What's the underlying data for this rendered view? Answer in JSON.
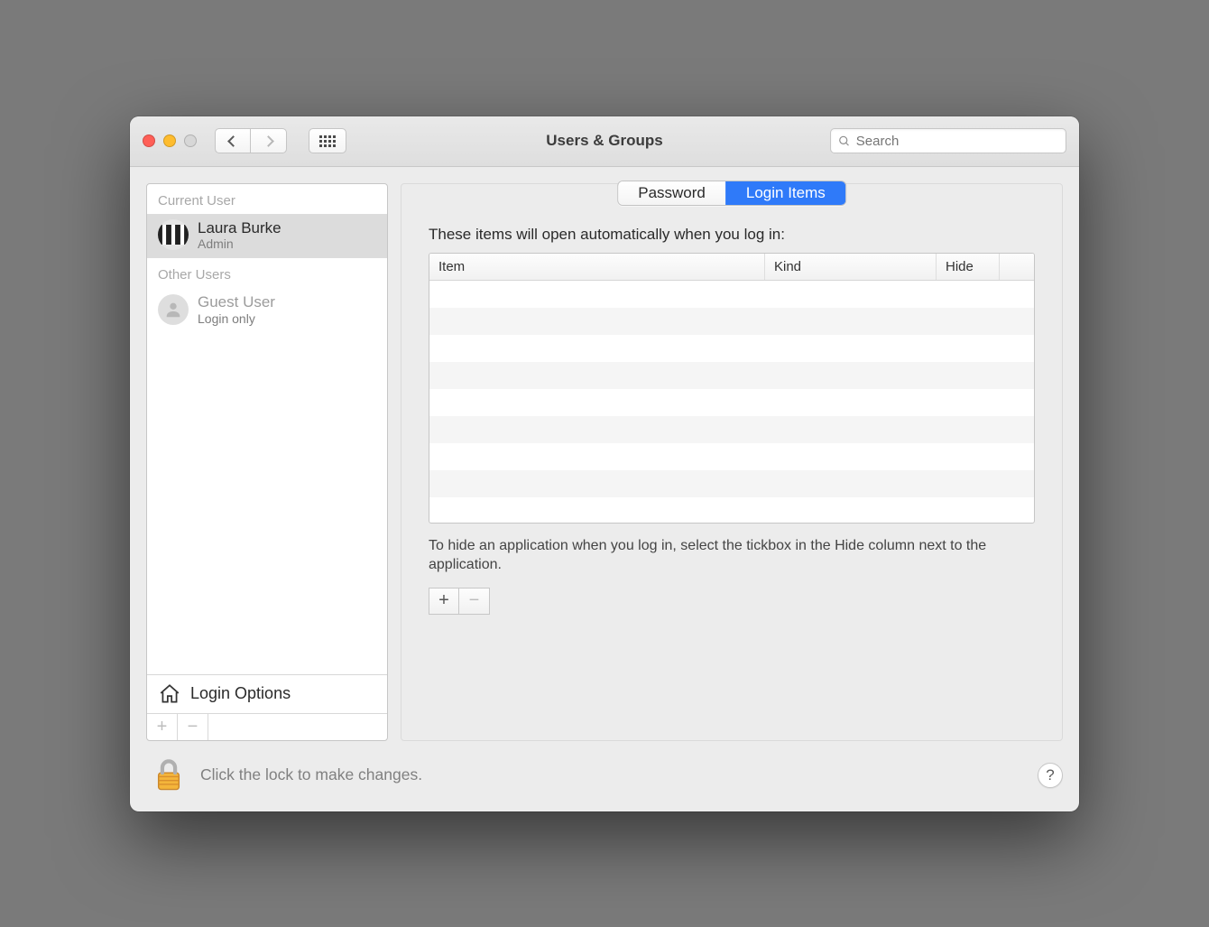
{
  "window": {
    "title": "Users & Groups"
  },
  "search": {
    "placeholder": "Search"
  },
  "tabs": {
    "password": "Password",
    "login_items": "Login Items"
  },
  "sidebar": {
    "section_current": "Current User",
    "section_other": "Other Users",
    "current": {
      "name": "Laura Burke",
      "role": "Admin"
    },
    "guest": {
      "name": "Guest User",
      "role": "Login only"
    },
    "login_options": "Login Options"
  },
  "main": {
    "header": "These items will open automatically when you log in:",
    "col_item": "Item",
    "col_kind": "Kind",
    "col_hide": "Hide",
    "hint": "To hide an application when you log in, select the tickbox in the Hide column next to the application."
  },
  "lock": {
    "text": "Click the lock to make changes."
  }
}
